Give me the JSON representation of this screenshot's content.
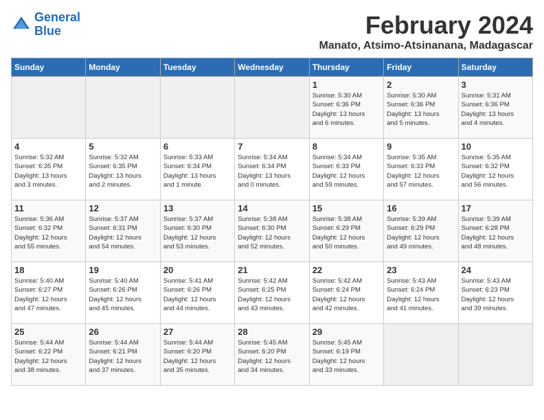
{
  "logo": {
    "line1": "General",
    "line2": "Blue"
  },
  "title": "February 2024",
  "location": "Manato, Atsimo-Atsinanana, Madagascar",
  "days_of_week": [
    "Sunday",
    "Monday",
    "Tuesday",
    "Wednesday",
    "Thursday",
    "Friday",
    "Saturday"
  ],
  "weeks": [
    [
      {
        "num": "",
        "detail": ""
      },
      {
        "num": "",
        "detail": ""
      },
      {
        "num": "",
        "detail": ""
      },
      {
        "num": "",
        "detail": ""
      },
      {
        "num": "1",
        "detail": "Sunrise: 5:30 AM\nSunset: 6:36 PM\nDaylight: 13 hours\nand 6 minutes."
      },
      {
        "num": "2",
        "detail": "Sunrise: 5:30 AM\nSunset: 6:36 PM\nDaylight: 13 hours\nand 5 minutes."
      },
      {
        "num": "3",
        "detail": "Sunrise: 5:31 AM\nSunset: 6:36 PM\nDaylight: 13 hours\nand 4 minutes."
      }
    ],
    [
      {
        "num": "4",
        "detail": "Sunrise: 5:32 AM\nSunset: 6:35 PM\nDaylight: 13 hours\nand 3 minutes."
      },
      {
        "num": "5",
        "detail": "Sunrise: 5:32 AM\nSunset: 6:35 PM\nDaylight: 13 hours\nand 2 minutes."
      },
      {
        "num": "6",
        "detail": "Sunrise: 5:33 AM\nSunset: 6:34 PM\nDaylight: 13 hours\nand 1 minute."
      },
      {
        "num": "7",
        "detail": "Sunrise: 5:34 AM\nSunset: 6:34 PM\nDaylight: 13 hours\nand 0 minutes."
      },
      {
        "num": "8",
        "detail": "Sunrise: 5:34 AM\nSunset: 6:33 PM\nDaylight: 12 hours\nand 59 minutes."
      },
      {
        "num": "9",
        "detail": "Sunrise: 5:35 AM\nSunset: 6:33 PM\nDaylight: 12 hours\nand 57 minutes."
      },
      {
        "num": "10",
        "detail": "Sunrise: 5:35 AM\nSunset: 6:32 PM\nDaylight: 12 hours\nand 56 minutes."
      }
    ],
    [
      {
        "num": "11",
        "detail": "Sunrise: 5:36 AM\nSunset: 6:32 PM\nDaylight: 12 hours\nand 55 minutes."
      },
      {
        "num": "12",
        "detail": "Sunrise: 5:37 AM\nSunset: 6:31 PM\nDaylight: 12 hours\nand 54 minutes."
      },
      {
        "num": "13",
        "detail": "Sunrise: 5:37 AM\nSunset: 6:30 PM\nDaylight: 12 hours\nand 53 minutes."
      },
      {
        "num": "14",
        "detail": "Sunrise: 5:38 AM\nSunset: 6:30 PM\nDaylight: 12 hours\nand 52 minutes."
      },
      {
        "num": "15",
        "detail": "Sunrise: 5:38 AM\nSunset: 6:29 PM\nDaylight: 12 hours\nand 50 minutes."
      },
      {
        "num": "16",
        "detail": "Sunrise: 5:39 AM\nSunset: 6:29 PM\nDaylight: 12 hours\nand 49 minutes."
      },
      {
        "num": "17",
        "detail": "Sunrise: 5:39 AM\nSunset: 6:28 PM\nDaylight: 12 hours\nand 48 minutes."
      }
    ],
    [
      {
        "num": "18",
        "detail": "Sunrise: 5:40 AM\nSunset: 6:27 PM\nDaylight: 12 hours\nand 47 minutes."
      },
      {
        "num": "19",
        "detail": "Sunrise: 5:40 AM\nSunset: 6:26 PM\nDaylight: 12 hours\nand 45 minutes."
      },
      {
        "num": "20",
        "detail": "Sunrise: 5:41 AM\nSunset: 6:26 PM\nDaylight: 12 hours\nand 44 minutes."
      },
      {
        "num": "21",
        "detail": "Sunrise: 5:42 AM\nSunset: 6:25 PM\nDaylight: 12 hours\nand 43 minutes."
      },
      {
        "num": "22",
        "detail": "Sunrise: 5:42 AM\nSunset: 6:24 PM\nDaylight: 12 hours\nand 42 minutes."
      },
      {
        "num": "23",
        "detail": "Sunrise: 5:43 AM\nSunset: 6:24 PM\nDaylight: 12 hours\nand 41 minutes."
      },
      {
        "num": "24",
        "detail": "Sunrise: 5:43 AM\nSunset: 6:23 PM\nDaylight: 12 hours\nand 39 minutes."
      }
    ],
    [
      {
        "num": "25",
        "detail": "Sunrise: 5:44 AM\nSunset: 6:22 PM\nDaylight: 12 hours\nand 38 minutes."
      },
      {
        "num": "26",
        "detail": "Sunrise: 5:44 AM\nSunset: 6:21 PM\nDaylight: 12 hours\nand 37 minutes."
      },
      {
        "num": "27",
        "detail": "Sunrise: 5:44 AM\nSunset: 6:20 PM\nDaylight: 12 hours\nand 35 minutes."
      },
      {
        "num": "28",
        "detail": "Sunrise: 5:45 AM\nSunset: 6:20 PM\nDaylight: 12 hours\nand 34 minutes."
      },
      {
        "num": "29",
        "detail": "Sunrise: 5:45 AM\nSunset: 6:19 PM\nDaylight: 12 hours\nand 33 minutes."
      },
      {
        "num": "",
        "detail": ""
      },
      {
        "num": "",
        "detail": ""
      }
    ]
  ]
}
